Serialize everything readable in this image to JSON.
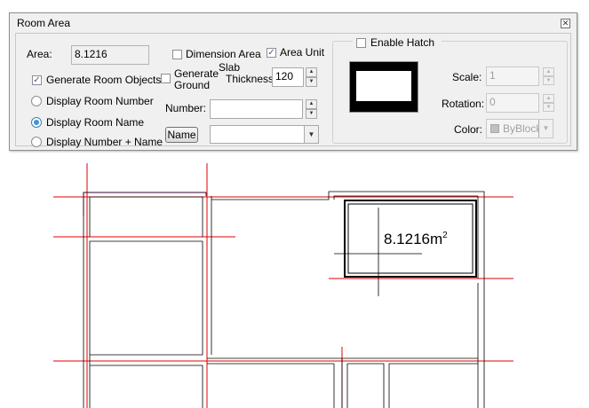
{
  "dialog": {
    "title": "Room Area",
    "close_glyph": "✕",
    "area_label": "Area:",
    "area_value": "8.1216",
    "generate_room_objects": {
      "label": "Generate Room Objects",
      "checked": true
    },
    "display_mode": {
      "options": [
        "Display Room Number",
        "Display Room Name",
        "Display Number + Name"
      ],
      "selected": "Display Room Name"
    },
    "dimension_area": {
      "label": "Dimension Area",
      "checked": false
    },
    "area_unit": {
      "label": "Area Unit",
      "checked": true
    },
    "generate_ground": {
      "label_line1": "Generate",
      "label_line2": "Ground",
      "checked": false
    },
    "slab_thickness": {
      "label_line1": "Slab",
      "label_line2": "Thickness:",
      "value": "120"
    },
    "number_label": "Number:",
    "number_value": "",
    "name_button": "Name",
    "name_value": "",
    "enable_hatch": {
      "label": "Enable Hatch",
      "checked": false
    },
    "scale": {
      "label": "Scale:",
      "value": "1"
    },
    "rotation": {
      "label": "Rotation:",
      "value": "0"
    },
    "color": {
      "label": "Color:",
      "value": "ByBlock"
    }
  },
  "drawing": {
    "room_area_label": "8.1216m",
    "superscript": "2",
    "colors": {
      "axis": "#e00000",
      "wall": "#000000",
      "highlight": "#c000c0"
    }
  }
}
